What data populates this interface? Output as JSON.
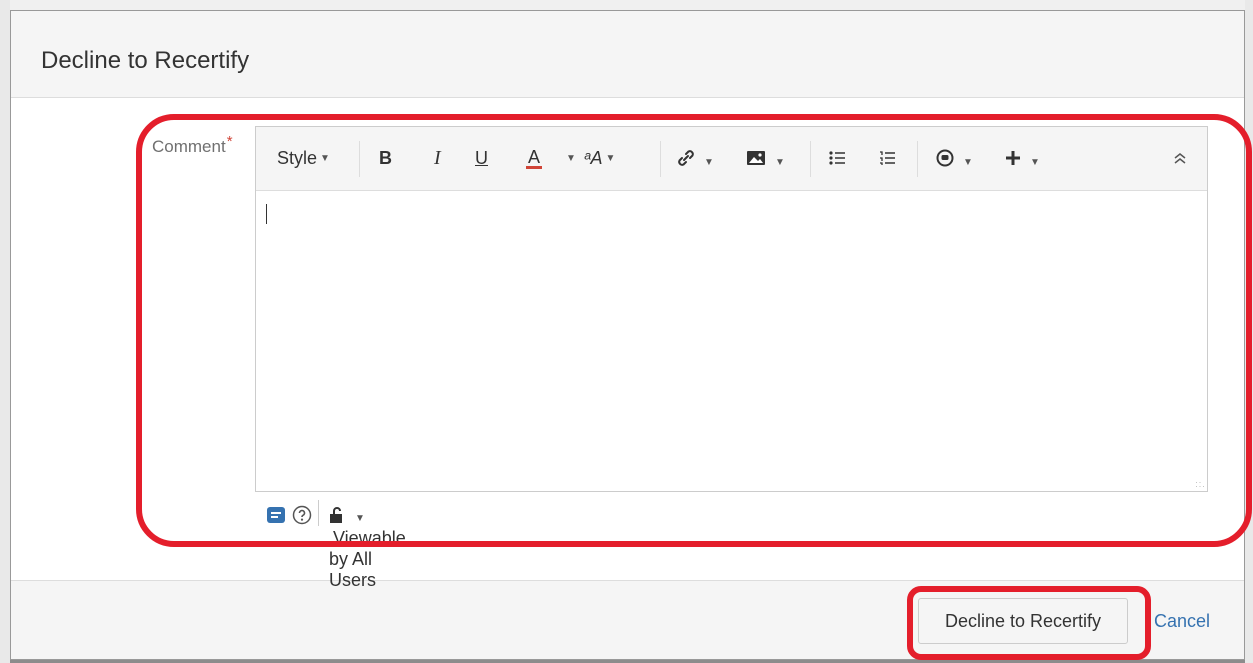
{
  "dialog": {
    "title": "Decline to Recertify"
  },
  "form": {
    "comment_label": "Comment",
    "required_marker": "*"
  },
  "toolbar": {
    "style_label": "Style",
    "bold_label": "B",
    "italic_label": "I",
    "underline_label": "U",
    "text_color_label": "A",
    "text_color_underline": "#d04437",
    "format_label": "ᵃA",
    "icons": [
      "link-icon",
      "image-icon",
      "bullet-list-icon",
      "numbered-list-icon",
      "emoticon-icon",
      "insert-icon",
      "collapse-icon"
    ]
  },
  "editor": {
    "value": ""
  },
  "status": {
    "visibility_label": "Viewable by All Users"
  },
  "footer": {
    "decline_button": "Decline to Recertify",
    "cancel_link": "Cancel"
  },
  "colors": {
    "highlight": "#e41e2b",
    "link": "#3572b0",
    "accent": "#3572b0"
  }
}
